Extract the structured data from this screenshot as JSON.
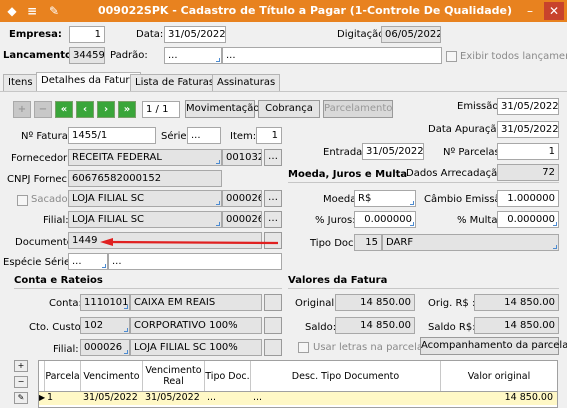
{
  "window": {
    "title": "009022SPK - Cadastro de Título a Pagar (1-Controle De Qualidade)",
    "menu_icon_label": "≡",
    "minimize_label": "–",
    "close_label": "✕"
  },
  "header": {
    "empresa_label": "Empresa:",
    "empresa_value": "1",
    "data_label": "Data:",
    "data_value": "31/05/2022",
    "digitacao_label": "Digitação:",
    "digitacao_value": "06/05/2022",
    "lancamento_label": "Lancamento:",
    "lancamento_value": "34459",
    "padrao_label": "Padrão:",
    "padrao_code": "...",
    "padrao_desc": "...",
    "exibir_label": "Exibir todos lançamentos"
  },
  "tabs": [
    {
      "label": "Itens"
    },
    {
      "label": "Detalhes da Fatura"
    },
    {
      "label": "Lista de Faturas"
    },
    {
      "label": "Assinaturas"
    }
  ],
  "toolbar": {
    "page_value": "1 / 1",
    "movimentacao_label": "Movimentação",
    "cobranca_label": "Cobrança",
    "parcelamento_label": "Parcelamento"
  },
  "fatura": {
    "nfatura_label": "Nº Fatura:",
    "nfatura_value": "1455/1",
    "serie_label": "Série:",
    "serie_value": "...",
    "item_label": "Item:",
    "item_value": "1",
    "fornecedor_label": "Fornecedor:",
    "fornecedor_value": "RECEITA FEDERAL",
    "fornecedor_code": "001032",
    "cnpj_label": "CNPJ Fornec.:",
    "cnpj_value": "60676582000152",
    "sacado_label": "Sacado:",
    "sacado_value": "LOJA FILIAL SC",
    "sacado_code": "000026",
    "filial_label": "Filial:",
    "filial_value": "LOJA FILIAL SC",
    "filial_code": "000026",
    "documento_label": "Documento:",
    "documento_value": "1449",
    "especie_label": "Espécie Série:",
    "especie_value1": "...",
    "especie_value2": "..."
  },
  "right": {
    "emissao_label": "Emissão:",
    "emissao_value": "31/05/2022",
    "apuracao_label": "Data Apuração:",
    "apuracao_value": "31/05/2022",
    "entrada_label": "Entrada:",
    "entrada_value": "31/05/2022",
    "nparcelas_label": "Nº Parcelas:",
    "nparcelas_value": "1",
    "dados_label": "Dados Arrecadação:",
    "dados_value": "72"
  },
  "moeda": {
    "section_title": "Moeda, Juros e Multa",
    "moeda_label": "Moeda:",
    "moeda_value": "R$",
    "cambio_label": "Câmbio Emissão:",
    "cambio_value": "1.000000",
    "juros_label": "% Juros:",
    "juros_value": "0.000000",
    "multa_label": "% Multa:",
    "multa_value": "0.000000",
    "tipodoc_label": "Tipo Doc.:",
    "tipodoc_code": "15",
    "tipodoc_value": "DARF"
  },
  "conta": {
    "section_title": "Conta e Rateios",
    "conta_label": "Conta:",
    "conta_code": "1110101",
    "conta_value": "CAIXA EM REAIS",
    "custo_label": "Cto. Custo:",
    "custo_code": "102",
    "custo_value": "CORPORATIVO 100%",
    "filial_label": "Filial:",
    "filial_code": "000026",
    "filial_value": "LOJA FILIAL SC 100%"
  },
  "valores": {
    "section_title": "Valores da Fatura",
    "original_label": "Original:",
    "original_value": "14 850.00",
    "orig_rs_label": "Orig. R$ :",
    "orig_rs_value": "14 850.00",
    "saldo_label": "Saldo:",
    "saldo_value": "14 850.00",
    "saldo_rs_label": "Saldo R$:",
    "saldo_rs_value": "14 850.00",
    "letras_label": "Usar letras na parcela",
    "acomp_label": "Acompanhamento da parcela"
  },
  "grid": {
    "columns": [
      "Parcela",
      "Vencimento",
      "Vencimento Real",
      "Tipo Doc.",
      "Desc. Tipo Documento",
      "Valor original"
    ],
    "rows": [
      {
        "parcela": "1",
        "vencimento": "31/05/2022",
        "venc_real": "31/05/2022",
        "tipo": "...",
        "desc": "...",
        "valor": "14 850.00"
      }
    ]
  },
  "colors": {
    "titlebar": "#e8821f",
    "nav_green": "#3aa63a",
    "arrow_red": "#e02020",
    "grid_row": "#fff8c6"
  }
}
